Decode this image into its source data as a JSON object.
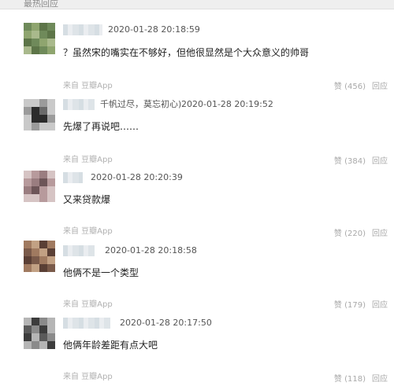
{
  "header": {
    "title": "最热回应"
  },
  "comments": [
    {
      "time": "2020-01-28 20:18:59",
      "nickname": "",
      "text": "？虽然宋的嘴实在不够好，但他很显然是个大众意义的帅哥",
      "source": "来自 豆瓣App",
      "likes": "赞 (456)",
      "reply": "回应"
    },
    {
      "time": "2020-01-28 20:19:52",
      "nickname": "千帆过尽，莫忘初心)",
      "text": "先爆了再说吧……",
      "source": "来自 豆瓣App",
      "likes": "赞 (384)",
      "reply": "回应"
    },
    {
      "time": "2020-01-28 20:20:39",
      "nickname": "",
      "text": "又来贷款爆",
      "source": "来自 豆瓣App",
      "likes": "赞 (220)",
      "reply": "回应"
    },
    {
      "time": "2020-01-28 20:18:58",
      "nickname": "",
      "text": "他俩不是一个类型",
      "source": "来自 豆瓣App",
      "likes": "赞 (179)",
      "reply": "回应"
    },
    {
      "time": "2020-01-28 20:17:50",
      "nickname": "",
      "text": "他俩年龄差距有点大吧",
      "source": "来自 豆瓣App",
      "likes": "赞 (118)",
      "reply": "回应"
    }
  ],
  "colors": {
    "avatar_palettes": [
      [
        "#6f8a5a",
        "#8fa56f",
        "#5d7548",
        "#a9b98c"
      ],
      [
        "#2b2b2b",
        "#6a6a6a",
        "#9b9b9b",
        "#c9c9c9"
      ],
      [
        "#9a7d80",
        "#b79a9c",
        "#6d5558",
        "#d6c4c4"
      ],
      [
        "#7a5a4a",
        "#a07a60",
        "#c2a184",
        "#5a3f35"
      ],
      [
        "#5a5a5a",
        "#8a8a8a",
        "#b5b5b5",
        "#3c3c3c"
      ]
    ]
  }
}
